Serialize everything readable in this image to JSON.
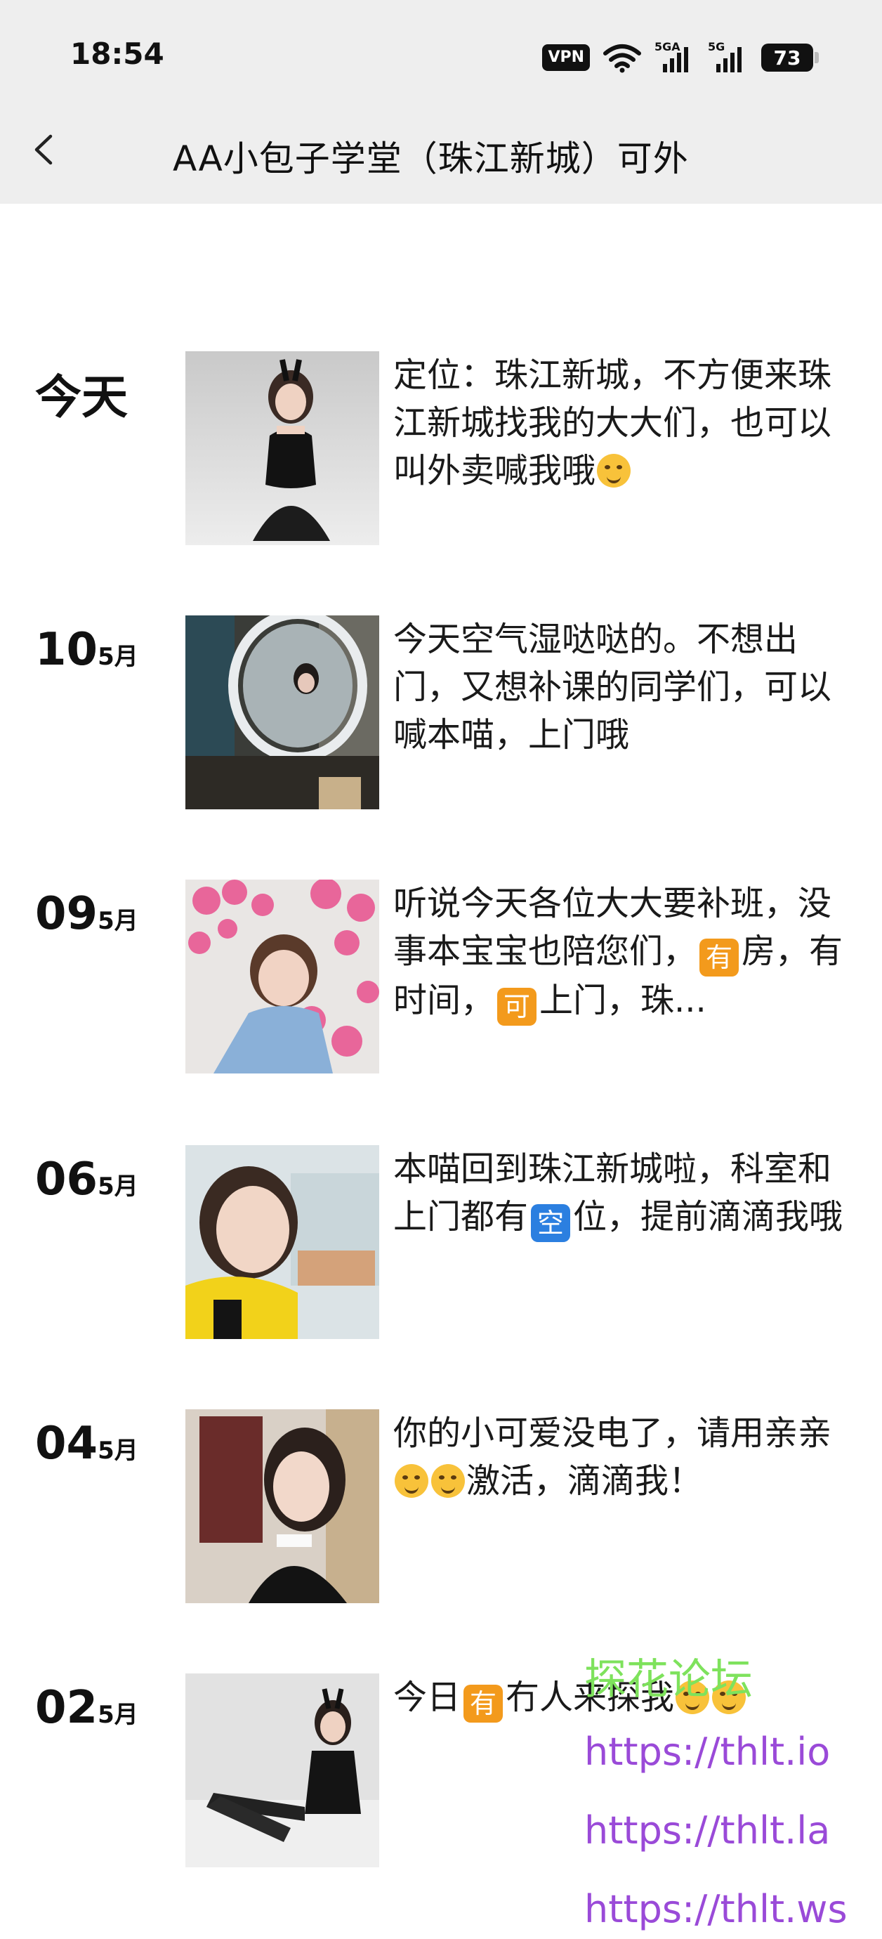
{
  "status_bar": {
    "time": "18:54",
    "vpn": "VPN",
    "signal1_label": "5GA",
    "signal2_label": "5G",
    "battery": "73"
  },
  "header": {
    "title": "AA小包子学堂（珠江新城）可外",
    "back_icon": "chevron-left-icon"
  },
  "entries": [
    {
      "day": "今天",
      "month": "",
      "text_parts": [
        "定位：珠江新城，不方便来珠江新城找我的大大们，也可以叫外卖喊我哦"
      ]
    },
    {
      "day": "10",
      "month": "5月",
      "text_parts": [
        "今天空气湿哒哒的。不想出门，又想补课的同学们，可以喊本喵，上门哦"
      ]
    },
    {
      "day": "09",
      "month": "5月",
      "text_parts": [
        "听说今天各位大大要补班，没事本宝宝也陪您们，",
        "有",
        "房，有时间，",
        "可",
        "上门，珠..."
      ]
    },
    {
      "day": "06",
      "month": "5月",
      "text_parts": [
        "本喵回到珠江新城啦，科室和上门都有",
        "空",
        "位，提前滴滴我哦"
      ]
    },
    {
      "day": "04",
      "month": "5月",
      "text_parts": [
        "你的小可爱没电了，请用亲亲",
        "激活，滴滴我！"
      ]
    },
    {
      "day": "02",
      "month": "5月",
      "text_parts": [
        "今日",
        "有",
        "冇人来探我"
      ]
    }
  ],
  "watermark": {
    "line1": "探花论坛",
    "line2": "https://thlt.io",
    "line3": "https://thlt.la",
    "line4": "https://thlt.ws"
  }
}
